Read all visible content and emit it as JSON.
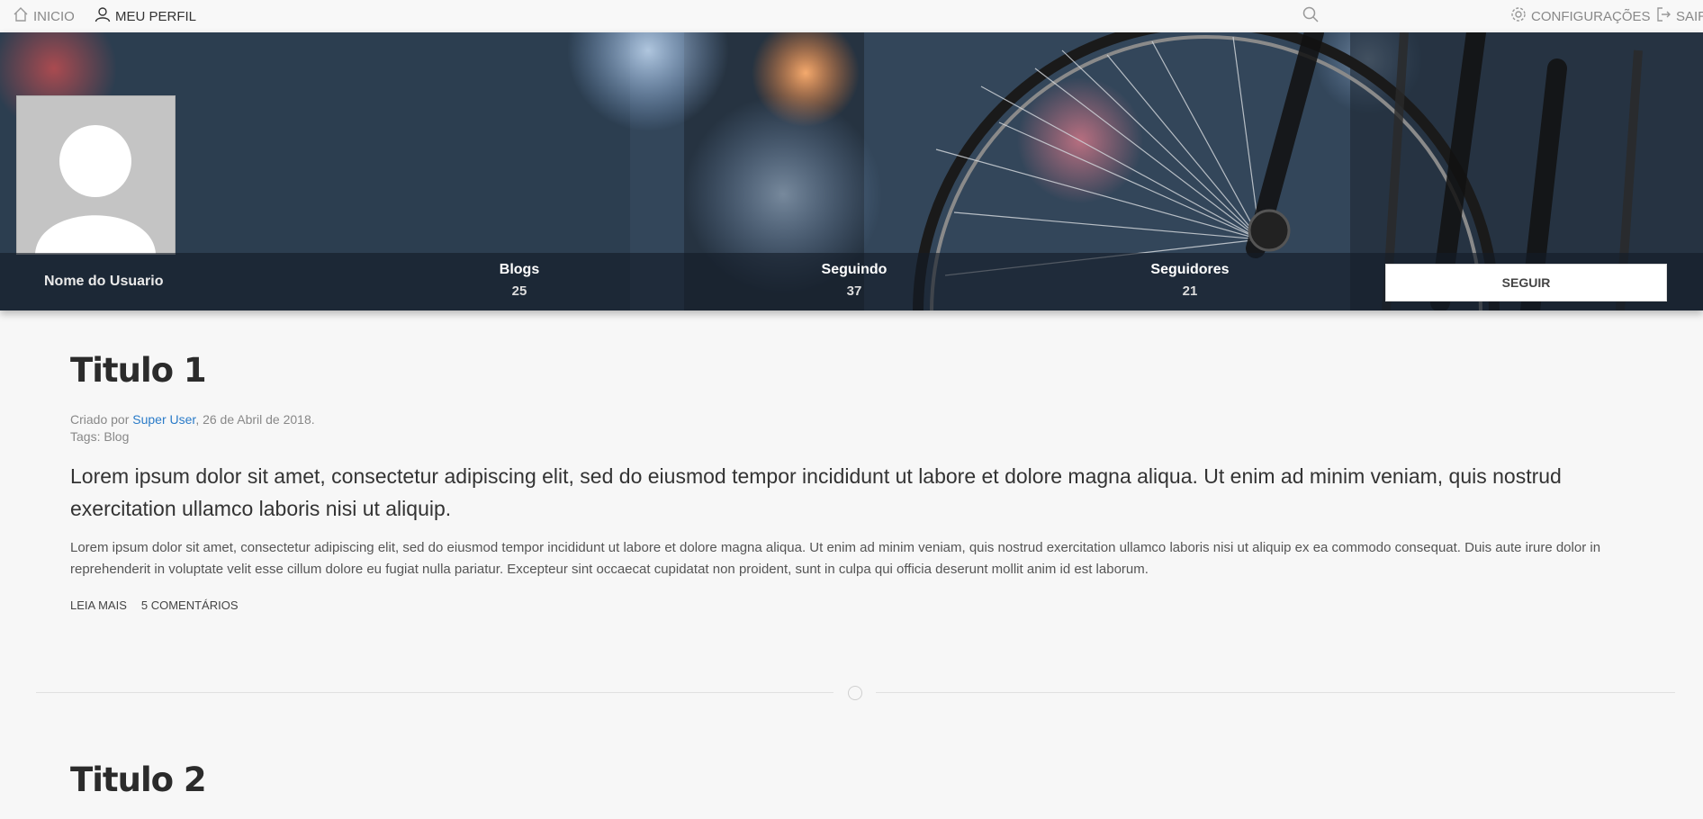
{
  "nav": {
    "home_label": "INICIO",
    "profile_label": "MEU PERFIL",
    "settings_label": "CONFIGURAÇÕES",
    "logout_label": "SAIR"
  },
  "profile": {
    "username": "Nome do Usuario",
    "stats": [
      {
        "label": "Blogs",
        "value": "25"
      },
      {
        "label": "Seguindo",
        "value": "37"
      },
      {
        "label": "Seguidores",
        "value": "21"
      }
    ],
    "follow_label": "SEGUIR"
  },
  "posts": [
    {
      "title": "Titulo 1",
      "meta_prefix": "Criado por ",
      "author": "Super User",
      "meta_date": ", 26 de Abril de 2018.",
      "tags": "Tags: Blog",
      "lead": "Lorem ipsum dolor sit amet, consectetur adipiscing elit, sed do eiusmod tempor incididunt ut labore et dolore magna aliqua. Ut enim ad minim veniam, quis nostrud exercitation ullamco laboris nisi ut aliquip.",
      "body": "Lorem ipsum dolor sit amet, consectetur adipiscing elit, sed do eiusmod tempor incididunt ut labore et dolore magna aliqua. Ut enim ad minim veniam, quis nostrud exercitation ullamco laboris nisi ut aliquip ex ea commodo consequat. Duis aute irure dolor in reprehenderit in voluptate velit esse cillum dolore eu fugiat nulla pariatur. Excepteur sint occaecat cupidatat non proident, sunt in culpa qui officia deserunt mollit anim id est laborum.",
      "read_more": "LEIA MAIS",
      "comments": "5 COMENTÁRIOS"
    },
    {
      "title": "Titulo 2"
    }
  ]
}
